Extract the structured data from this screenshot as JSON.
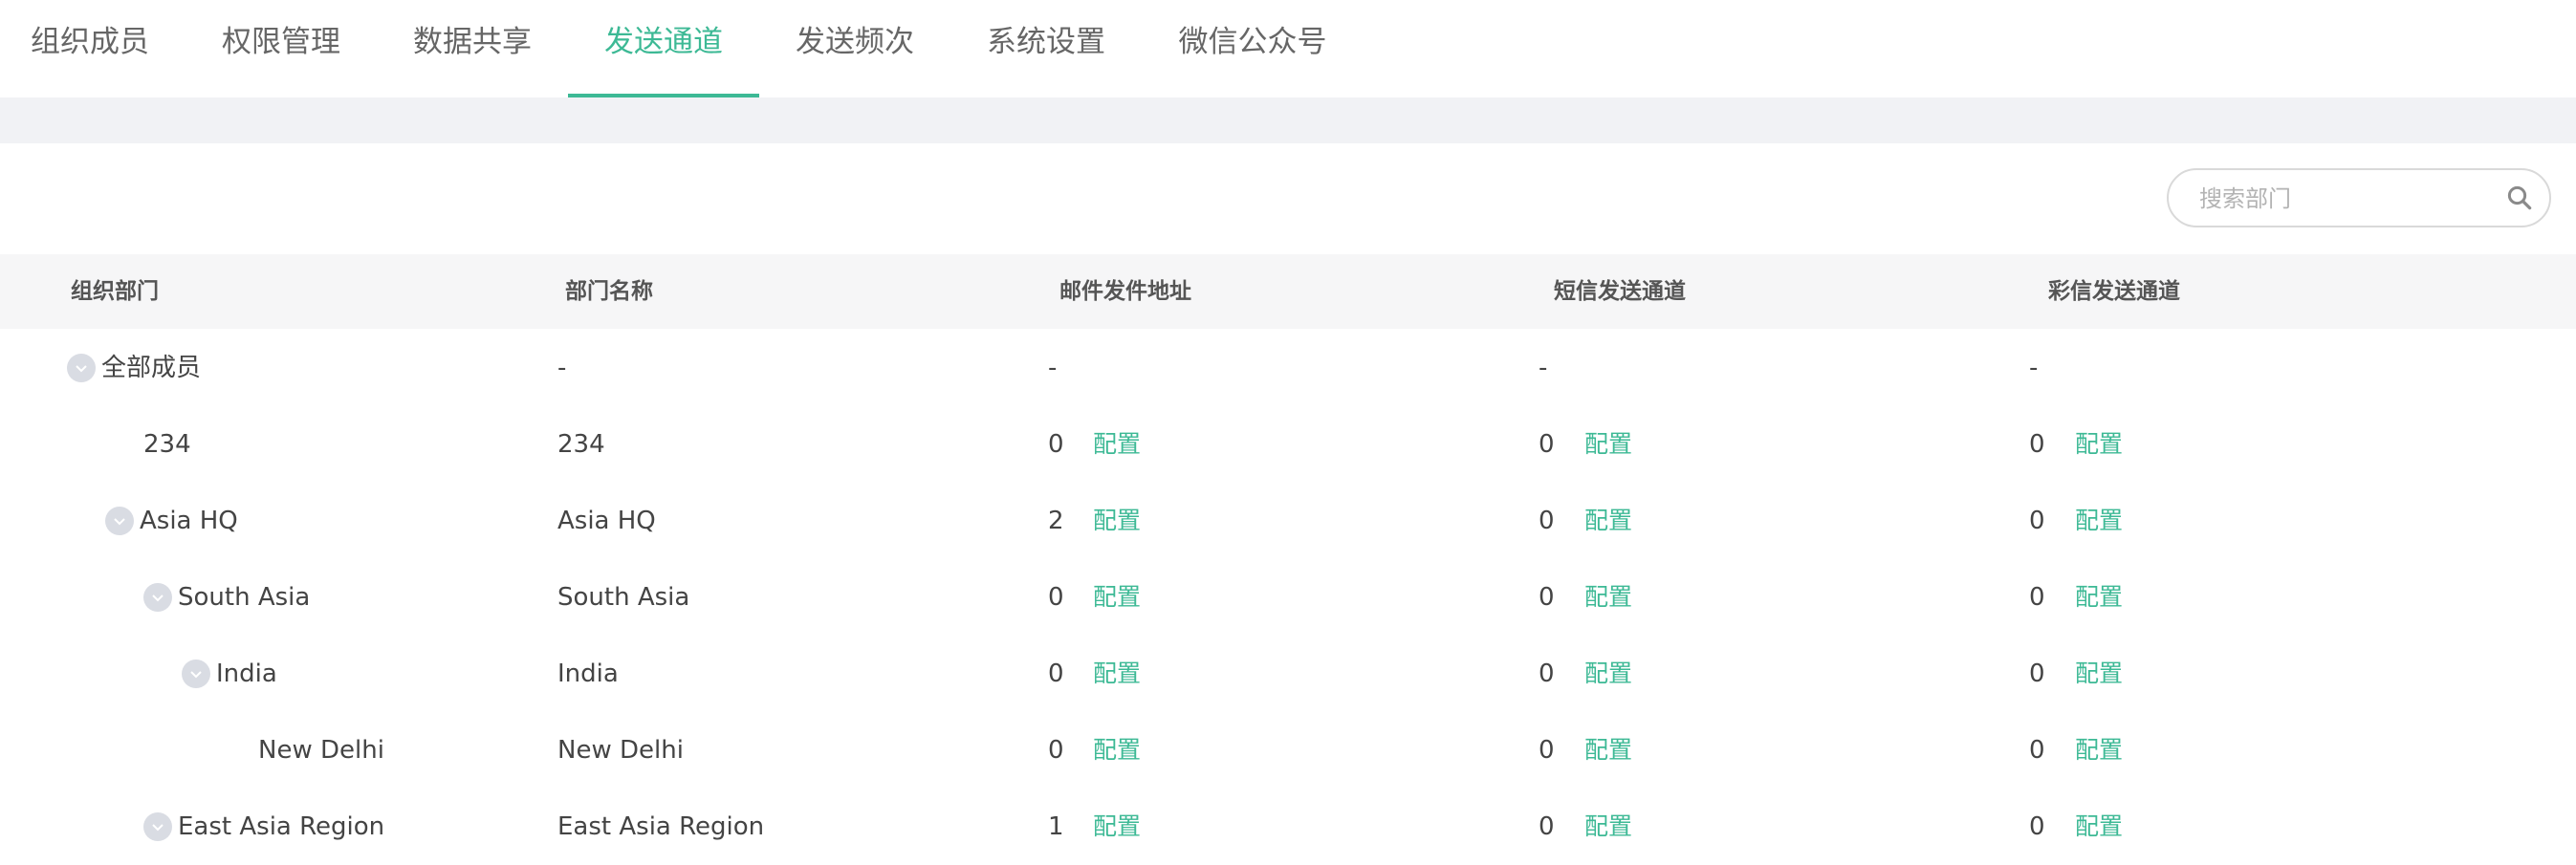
{
  "tabs": [
    {
      "label": "组织成员"
    },
    {
      "label": "权限管理"
    },
    {
      "label": "数据共享"
    },
    {
      "label": "发送通道",
      "active": true
    },
    {
      "label": "发送频次"
    },
    {
      "label": "系统设置"
    },
    {
      "label": "微信公众号"
    }
  ],
  "search": {
    "placeholder": "搜索部门"
  },
  "columns": [
    "组织部门",
    "部门名称",
    "邮件发件地址",
    "短信发送通道",
    "彩信发送通道"
  ],
  "config_label": "配置",
  "rows": [
    {
      "tree": "全部成员",
      "expandable": true,
      "name": "-",
      "email": "-",
      "sms": "-",
      "mms": "-"
    },
    {
      "tree": "234",
      "expandable": false,
      "name": "234",
      "email": "0",
      "sms": "0",
      "mms": "0"
    },
    {
      "tree": "Asia HQ",
      "expandable": true,
      "name": "Asia HQ",
      "email": "2",
      "sms": "0",
      "mms": "0"
    },
    {
      "tree": "South Asia",
      "expandable": true,
      "name": "South Asia",
      "email": "0",
      "sms": "0",
      "mms": "0"
    },
    {
      "tree": "India",
      "expandable": true,
      "name": "India",
      "email": "0",
      "sms": "0",
      "mms": "0"
    },
    {
      "tree": "New Delhi",
      "expandable": false,
      "name": "New Delhi",
      "email": "0",
      "sms": "0",
      "mms": "0"
    },
    {
      "tree": "East Asia Region",
      "expandable": true,
      "name": "East Asia Region",
      "email": "1",
      "sms": "0",
      "mms": "0"
    }
  ],
  "colors": {
    "accent": "#3db995",
    "toggle": "#d9dce3"
  }
}
